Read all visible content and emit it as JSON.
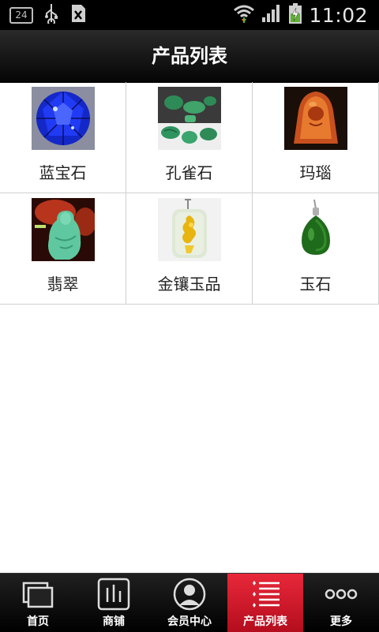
{
  "status_bar": {
    "notification_count": "24",
    "time": "11:02",
    "icons": [
      "usb-icon",
      "sd-card-icon",
      "wifi-icon",
      "signal-icon",
      "battery-charging-icon"
    ]
  },
  "header": {
    "title": "产品列表"
  },
  "products": [
    {
      "label": "蓝宝石",
      "icon": "sapphire-thumbnail"
    },
    {
      "label": "孔雀石",
      "icon": "malachite-thumbnail"
    },
    {
      "label": "玛瑙",
      "icon": "agate-thumbnail"
    },
    {
      "label": "翡翠",
      "icon": "jadeite-thumbnail"
    },
    {
      "label": "金镶玉品",
      "icon": "gold-inlaid-jade-thumbnail"
    },
    {
      "label": "玉石",
      "icon": "jade-pendant-thumbnail"
    }
  ],
  "bottom_nav": {
    "active_index": 3,
    "active_color": "#d71a2b",
    "items": [
      {
        "label": "首页",
        "icon": "home-icon"
      },
      {
        "label": "商铺",
        "icon": "shop-icon"
      },
      {
        "label": "会员中心",
        "icon": "member-icon"
      },
      {
        "label": "产品列表",
        "icon": "product-list-icon"
      },
      {
        "label": "更多",
        "icon": "more-icon"
      }
    ]
  }
}
